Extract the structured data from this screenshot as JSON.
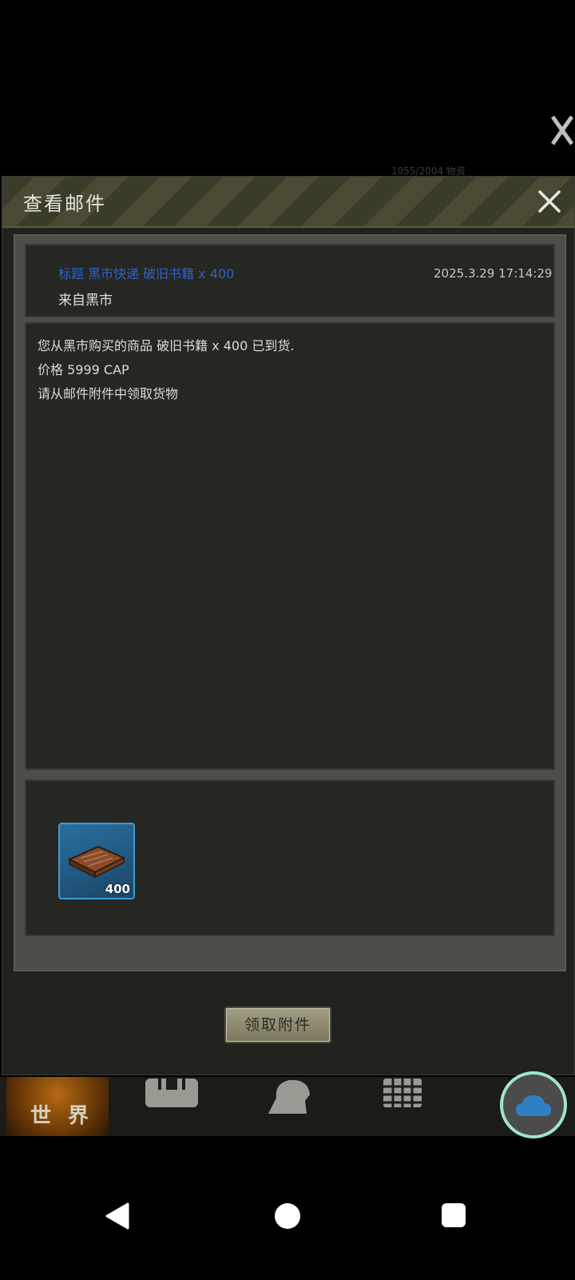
{
  "background": {
    "faint_top_text": "1055/2004   物资"
  },
  "dialog": {
    "title": "查看邮件",
    "close_icon": "close-icon",
    "mail": {
      "subject": "标题 黑市快递 破旧书籍 x 400",
      "date": "2025.3.29 17:14:29",
      "from": "来自黑市",
      "body_lines": [
        "您从黑市购买的商品 破旧书籍 x 400 已到货.",
        "价格 5999 CAP",
        "请从邮件附件中领取货物"
      ]
    },
    "attachment": {
      "icon": "old-books-icon",
      "quantity": "400"
    },
    "claim_button": "领取附件"
  },
  "bottom_nav": {
    "world_label": "世 界",
    "icons": [
      "bag-icon",
      "head-profile-icon",
      "calendar-grid-icon"
    ]
  },
  "floating": {
    "icon": "cloud-icon"
  },
  "system_nav": {
    "icons": [
      "back-icon",
      "home-icon",
      "recents-icon"
    ]
  },
  "colors": {
    "subject_blue": "#2c63c9",
    "attachment_border": "#3f9ad6",
    "cloud_ring": "#9fe6c8"
  }
}
